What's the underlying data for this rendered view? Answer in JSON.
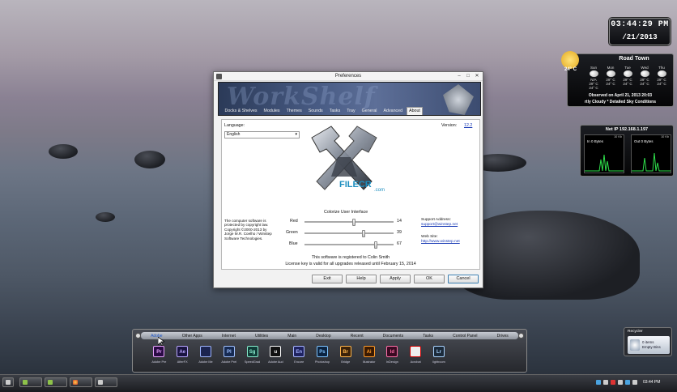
{
  "desktop": {
    "clock": {
      "time": "03:44:29 PM",
      "date": "/21/2013"
    },
    "weather": {
      "location": "Road Town",
      "current_temp": "24° C",
      "days": [
        {
          "name": "Sun",
          "hi": "29° C",
          "lo": "24° C"
        },
        {
          "name": "Mon",
          "hi": "29° C",
          "lo": "24° C"
        },
        {
          "name": "Tue",
          "hi": "29° C",
          "lo": "24° C"
        },
        {
          "name": "Wed",
          "hi": "29° C",
          "lo": "24° C"
        },
        {
          "name": "Thu",
          "hi": "29° C",
          "lo": "24° C"
        }
      ],
      "first_day_label": "N/A",
      "observed": "Observed on April 21, 2013 20:03",
      "condition": "rtly Cloudy * Detailed Sky Conditions"
    },
    "network": {
      "title": "Net IP 192.168.1.197",
      "in": {
        "label": "In 0 Bytes",
        "scale": "10 Kb"
      },
      "out": {
        "label": "Out 0 Bytes",
        "scale": "10 Kb"
      }
    },
    "recycler": {
      "title": "Recycler",
      "line1": "0 items",
      "line2": "Empty Bins"
    }
  },
  "dialog": {
    "title": "Preferences",
    "banner_text": "WorkShelf",
    "tabs": [
      "Docks & Shelves",
      "Modules",
      "Themes",
      "Sounds",
      "Tasks",
      "Tray",
      "General",
      "Advanced",
      "About"
    ],
    "active_tab": "About",
    "language_label": "Language:",
    "language_value": "English",
    "version_label": "Version:",
    "version_value": "12.2",
    "watermark": "FILECR",
    "watermark_sub": ".com",
    "colorize_label": "Colorize User Interface",
    "copyright": "The computer software is protected by copyright law. Copyright ©2000-2013 by Jorge M.R. Coelho / Winstep Software Technologies.",
    "sliders": [
      {
        "label": "Red",
        "value": "14",
        "fraction": 0.55
      },
      {
        "label": "Green",
        "value": "39",
        "fraction": 0.66
      },
      {
        "label": "Blue",
        "value": "67",
        "fraction": 0.8
      }
    ],
    "support_label": "Support Address:",
    "support_link": "support@winstep.net",
    "web_label": "Web Site:",
    "web_link": "http://www.winstep.net",
    "registered_to": "This software is registered to Colin Smith",
    "license": "License key is valid for all upgrades released until February 15, 2014",
    "buttons": [
      "Exit",
      "Help",
      "Apply",
      "OK",
      "Cancel"
    ]
  },
  "dock": {
    "categories": [
      "Adobe",
      "Other Apps",
      "Internet",
      "Utilities",
      "Main",
      "Desktop",
      "Recent",
      "Documents",
      "Tasks",
      "Control Panel",
      "Drives"
    ],
    "active_category": "Adobe",
    "apps": [
      {
        "abbr": "Pr",
        "name": "Adobe Pre",
        "color": "#2a0a44",
        "text": "#e9a4ff"
      },
      {
        "abbr": "Ae",
        "name": "AfterFX",
        "color": "#1a1440",
        "text": "#b9a6ff"
      },
      {
        "abbr": "",
        "name": "Adobe Me",
        "color": "#1b2450",
        "text": "#9fb6ff"
      },
      {
        "abbr": "Pl",
        "name": "Adobe Prel",
        "color": "#162a52",
        "text": "#a2c2ff"
      },
      {
        "abbr": "Sg",
        "name": "SpeedGrad",
        "color": "#0f3b36",
        "text": "#8af0d0"
      },
      {
        "abbr": "u",
        "name": "Adobe Aud",
        "color": "#111",
        "text": "#fff"
      },
      {
        "abbr": "En",
        "name": "Encore",
        "color": "#1e2260",
        "text": "#a8b6ff"
      },
      {
        "abbr": "Ps",
        "name": "Photoshop",
        "color": "#0b2340",
        "text": "#7fc4ff"
      },
      {
        "abbr": "Br",
        "name": "Bridge",
        "color": "#3a2108",
        "text": "#ffb54a"
      },
      {
        "abbr": "Ai",
        "name": "Illustrator",
        "color": "#3a1a02",
        "text": "#ff9c2a"
      },
      {
        "abbr": "Id",
        "name": "InDesign",
        "color": "#3a0a22",
        "text": "#ff6fa8"
      },
      {
        "abbr": "",
        "name": "Acrobat",
        "color": "#eee",
        "text": "#c00"
      },
      {
        "abbr": "Lr",
        "name": "lightroom",
        "color": "#1b2a3a",
        "text": "#aad4ff"
      }
    ]
  },
  "taskbar": {
    "time": "03:44 PM"
  }
}
